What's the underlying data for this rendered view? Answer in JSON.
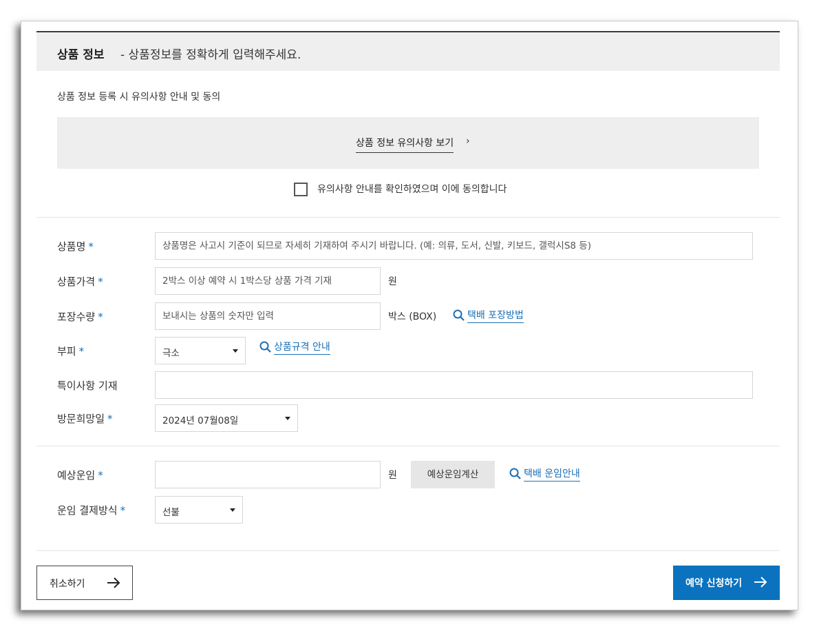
{
  "header": {
    "title": "상품 정보",
    "subtitle": "- 상품정보를 정확하게 입력해주세요."
  },
  "notice": {
    "label": "상품 정보 등록 시 유의사항 안내 및 동의",
    "link_text": "상품 정보 유의사항 보기",
    "link_arrow": "›",
    "agree_label": "유의사항 안내를 확인하였으며 이에 동의합니다",
    "agree_checked": false
  },
  "form": {
    "required_mark": "*",
    "product_name": {
      "label": "상품명",
      "placeholder": "상품명은 사고시 기준이 되므로 자세히 기재하여 주시기 바랍니다. (예: 의류, 도서, 신발, 키보드, 갤럭시S8 등)"
    },
    "product_price": {
      "label": "상품가격",
      "placeholder": "2박스 이상 예약 시 1박스당 상품 가격 기재",
      "unit": "원"
    },
    "package_qty": {
      "label": "포장수량",
      "placeholder": "보내시는 상품의 숫자만 입력",
      "unit": "박스 (BOX)",
      "guide_link": "택배 포장방법"
    },
    "volume": {
      "label": "부피",
      "selected": "극소",
      "guide_link": "상품규격 안내"
    },
    "special_notes": {
      "label": "특이사항 기재",
      "value": ""
    },
    "visit_date": {
      "label": "방문희망일",
      "selected": "2024년 07월08일"
    },
    "estimated_fare": {
      "label": "예상운임",
      "value": "",
      "unit": "원",
      "calc_button": "예상운임계산",
      "guide_link": "택배 운임안내"
    },
    "payment_method": {
      "label": "운임 결제방식",
      "selected": "선불"
    }
  },
  "actions": {
    "cancel_label": "취소하기",
    "submit_label": "예약 신청하기"
  },
  "colors": {
    "accent": "#0a72be",
    "link": "#1a6fb5",
    "header_bg": "#efefef"
  }
}
